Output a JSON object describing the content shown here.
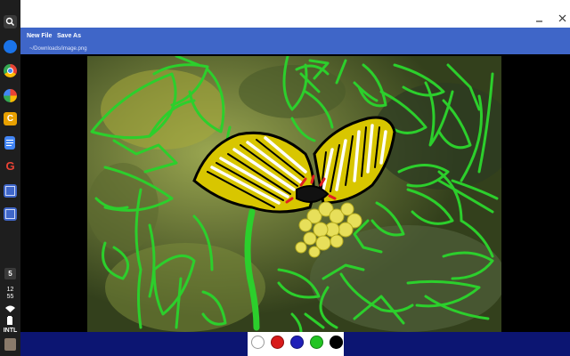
{
  "shelf": {
    "apps": [
      {
        "name": "launcher-search-icon"
      },
      {
        "name": "files-icon",
        "color": "#1a73e8"
      },
      {
        "name": "chrome-icon",
        "color": "#ea4335"
      },
      {
        "name": "photos-icon",
        "color": "#fbbc04"
      },
      {
        "name": "app-c-icon",
        "color": "#e8a000"
      },
      {
        "name": "docs-icon",
        "color": "#4285f4"
      },
      {
        "name": "google-icon",
        "color": "#ea4335"
      },
      {
        "name": "app-window-icon-1",
        "color": "#3f66c8"
      },
      {
        "name": "app-window-icon-2",
        "color": "#3f66c8"
      }
    ],
    "badge": "5",
    "time_hour": "12",
    "time_min": "55",
    "ime": "INTL"
  },
  "toolbar": {
    "new_file_label": "New File",
    "save_as_label": "Save As",
    "file_path": "~/Downloads/image.png"
  },
  "palette": {
    "colors": [
      "#ffffff",
      "#d81a1a",
      "#2020b8",
      "#22c422",
      "#000000"
    ],
    "selected": "#000000"
  }
}
